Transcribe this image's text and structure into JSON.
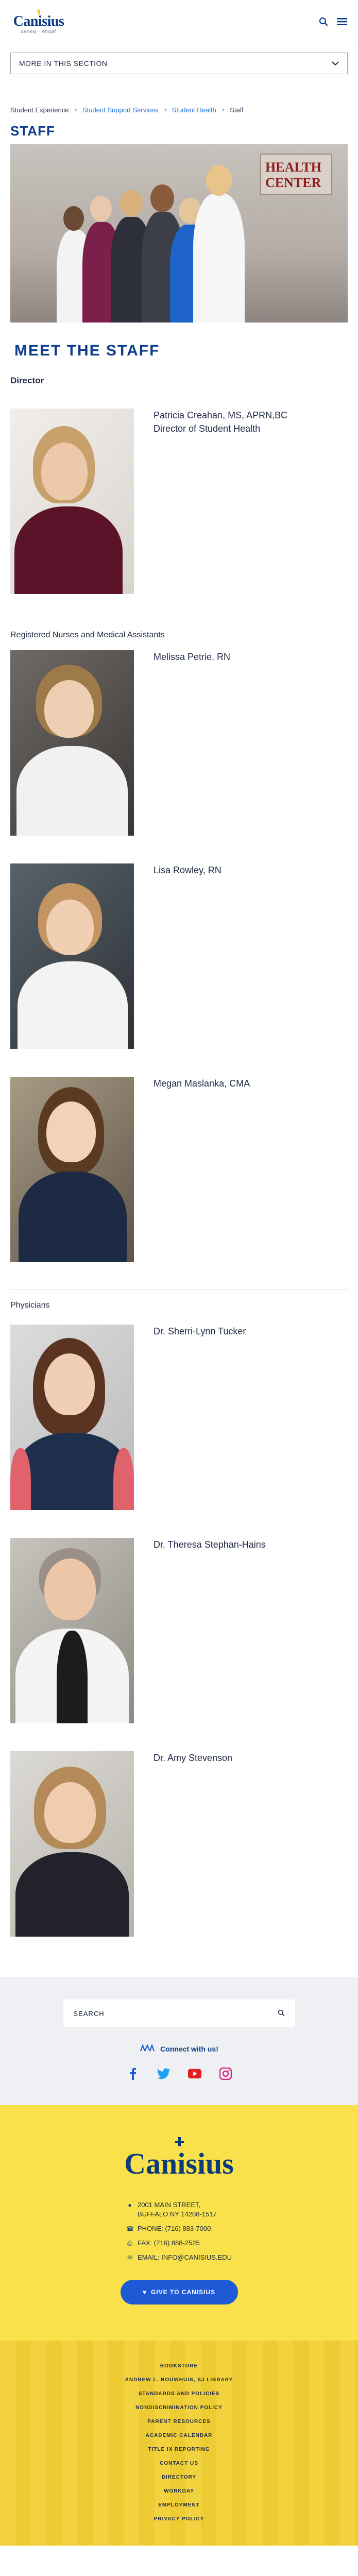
{
  "header": {
    "logo_text": "Canisius",
    "logo_tagline": "aeneq · ehqaf"
  },
  "section_nav": {
    "label": "MORE IN THIS SECTION"
  },
  "breadcrumb": {
    "items": [
      "Student Experience",
      "Student Support Services",
      "Student Health",
      "Staff"
    ]
  },
  "page": {
    "title": "STAFF",
    "hero_sign": "HEALTH CENTER",
    "meet_title": "MEET THE STAFF"
  },
  "groups": {
    "director": "Director",
    "nurses": "Registered Nurses and Medical Assistants",
    "physicians": "Physicians"
  },
  "staff": {
    "creahan": {
      "name": "Patricia Creahan, MS, APRN,BC",
      "role": "Director of Student Health"
    },
    "petrie": {
      "name": "Melissa Petrie, RN"
    },
    "rowley": {
      "name": "Lisa Rowley, RN"
    },
    "maslanka": {
      "name": "Megan Maslanka, CMA"
    },
    "tucker": {
      "name": "Dr. Sherri-Lynn Tucker"
    },
    "stephan": {
      "name": "Dr. Theresa Stephan-Hains"
    },
    "stevenson": {
      "name": "Dr. Amy Stevenson"
    }
  },
  "footer": {
    "search_placeholder": "SEARCH",
    "connect": "Connect with us!",
    "logo_text": "Canisius",
    "address_line1": "2001 MAIN STREET,",
    "address_line2": "BUFFALO NY 14208-1517",
    "phone": "PHONE: (716) 883-7000",
    "fax": "FAX: (716) 888-2525",
    "email": "EMAIL: INFO@CANISIUS.EDU",
    "give_label": "GIVE TO CANISIUS",
    "links": [
      "BOOKSTORE",
      "ANDREW L. BOUWHUIS, SJ LIBRARY",
      "STANDARDS AND POLICIES",
      "NONDISCRIMINATION POLICY",
      "PARENT RESOURCES",
      "ACADEMIC CALENDAR",
      "TITLE IX REPORTING",
      "CONTACT US",
      "DIRECTORY",
      "WORKDAY",
      "EMPLOYMENT",
      "PRIVACY POLICY"
    ]
  },
  "colors": {
    "brand_blue": "#0d3d8c",
    "link_blue": "#1f6fd6",
    "footer_yellow": "#f8e14b",
    "give_button": "#1f5ad6"
  }
}
